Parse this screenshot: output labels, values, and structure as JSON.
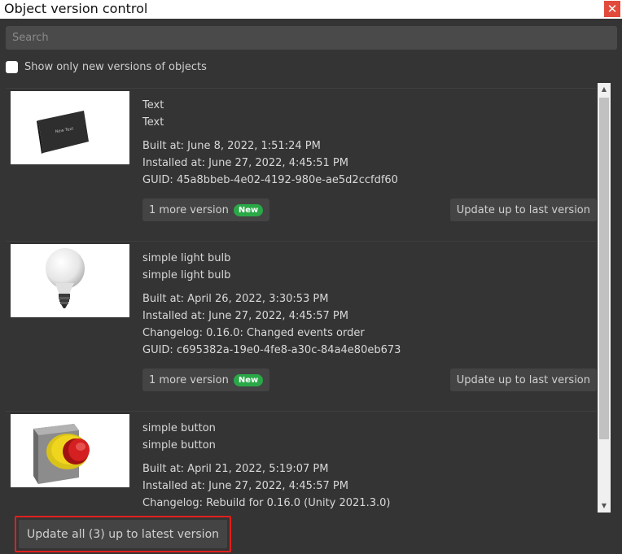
{
  "window": {
    "title": "Object version control",
    "close_symbol": "✕"
  },
  "search": {
    "placeholder": "Search",
    "value": ""
  },
  "filter": {
    "label": "Show only new versions of objects",
    "checked": false
  },
  "items": [
    {
      "name": "Text",
      "subtitle": "Text",
      "built": "Built at: June 8, 2022, 1:51:24 PM",
      "installed": "Installed at: June 27, 2022, 4:45:51 PM",
      "changelog": "",
      "guid": "GUID: 45a8bbeb-4e02-4192-980e-ae5d2ccfdf60",
      "more_label": "1 more version",
      "badge": "New",
      "update_label": "Update up to last version",
      "thumb_icon": "text-panel-icon",
      "thumb_text": "New Text"
    },
    {
      "name": "simple light bulb",
      "subtitle": "simple light bulb",
      "built": "Built at: April 26, 2022, 3:30:53 PM",
      "installed": "Installed at: June 27, 2022, 4:45:57 PM",
      "changelog": "Changelog: 0.16.0: Changed events order",
      "guid": "GUID: c695382a-19e0-4fe8-a30c-84a4e80eb673",
      "more_label": "1 more version",
      "badge": "New",
      "update_label": "Update up to last version",
      "thumb_icon": "light-bulb-icon"
    },
    {
      "name": "simple button",
      "subtitle": "simple button",
      "built": "Built at: April 21, 2022, 5:19:07 PM",
      "installed": "Installed at: June 27, 2022, 4:45:57 PM",
      "changelog": "Changelog: Rebuild for 0.16.0 (Unity 2021.3.0)",
      "thumb_icon": "push-button-icon"
    }
  ],
  "update_all_label": "Update all (3) up to latest version",
  "colors": {
    "accent_badge": "#2aa847",
    "highlight_border": "#e0201c",
    "panel_bg": "#343434"
  }
}
